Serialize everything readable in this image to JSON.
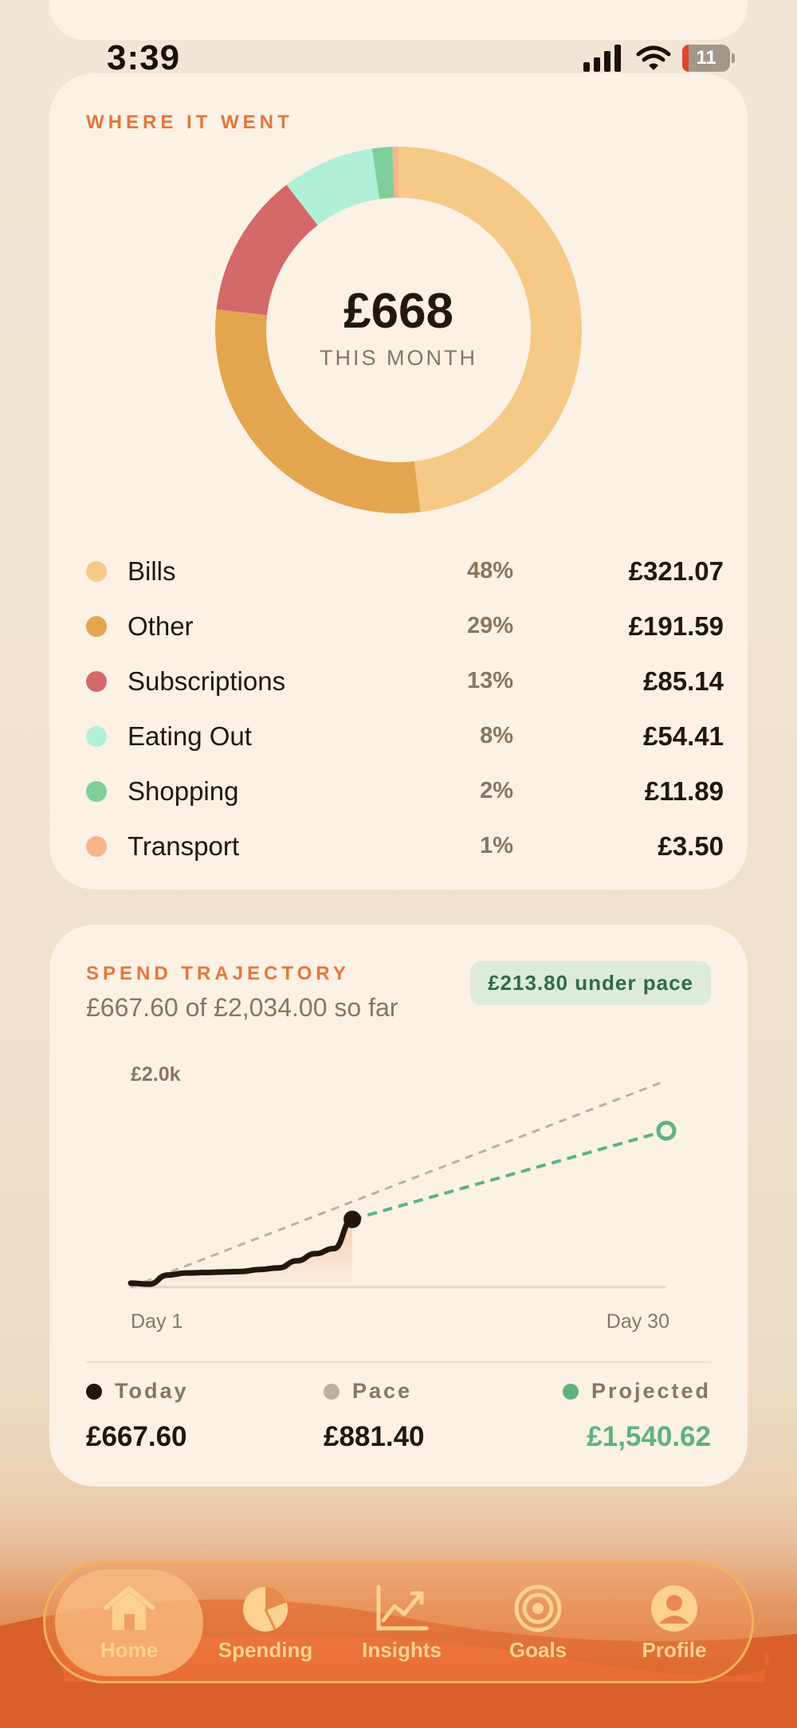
{
  "status_bar": {
    "time": "3:39",
    "battery": "11"
  },
  "where": {
    "title": "WHERE IT WENT",
    "total": "£668",
    "total_label": "THIS MONTH",
    "categories": [
      {
        "name": "Bills",
        "pct": "48%",
        "amount": "£321.07",
        "color": "#f6c987"
      },
      {
        "name": "Other",
        "pct": "29%",
        "amount": "£191.59",
        "color": "#e3a550"
      },
      {
        "name": "Subscriptions",
        "pct": "13%",
        "amount": "£85.14",
        "color": "#d4696a"
      },
      {
        "name": "Eating Out",
        "pct": "8%",
        "amount": "£54.41",
        "color": "#b1f0d6"
      },
      {
        "name": "Shopping",
        "pct": "2%",
        "amount": "£11.89",
        "color": "#7ecf9c"
      },
      {
        "name": "Transport",
        "pct": "1%",
        "amount": "£3.50",
        "color": "#f6b68a"
      }
    ]
  },
  "trajectory": {
    "title": "SPEND TRAJECTORY",
    "subtitle": "£667.60 of £2,034.00 so far",
    "badge": "£213.80 under pace",
    "y_label": "£2.0k",
    "x_start": "Day 1",
    "x_end": "Day 30",
    "stats": {
      "today_label": "Today",
      "today_value": "£667.60",
      "pace_label": "Pace",
      "pace_value": "£881.40",
      "projected_label": "Projected",
      "projected_value": "£1,540.62"
    },
    "colors": {
      "actual": "#24160c",
      "pace": "#bbb0a4",
      "projected": "#5cb47c"
    }
  },
  "chart_data": [
    {
      "type": "pie",
      "title": "WHERE IT WENT",
      "categories": [
        "Bills",
        "Other",
        "Subscriptions",
        "Eating Out",
        "Shopping",
        "Transport"
      ],
      "values": [
        321.07,
        191.59,
        85.14,
        54.41,
        11.89,
        3.5
      ],
      "percent": [
        48,
        29,
        13,
        8,
        2,
        1
      ],
      "colors": [
        "#f6c987",
        "#e3a550",
        "#d4696a",
        "#b1f0d6",
        "#7ecf9c",
        "#f6b68a"
      ]
    },
    {
      "type": "line",
      "title": "SPEND TRAJECTORY",
      "xlim": [
        1,
        30
      ],
      "ylim": [
        0,
        2000
      ],
      "series": [
        {
          "name": "Today",
          "x": [
            1,
            2,
            3,
            4,
            5,
            6,
            7,
            8,
            9,
            10,
            11,
            12,
            13
          ],
          "y": [
            40,
            30,
            120,
            140,
            145,
            150,
            155,
            175,
            190,
            260,
            330,
            380,
            667.6
          ]
        },
        {
          "name": "Pace",
          "x": [
            1,
            30
          ],
          "y": [
            0,
            2034
          ]
        },
        {
          "name": "Projected",
          "x": [
            13,
            30
          ],
          "y": [
            667.6,
            1540.62
          ]
        }
      ]
    }
  ],
  "nav": {
    "tabs": [
      {
        "label": "Home",
        "icon": "home-icon"
      },
      {
        "label": "Spending",
        "icon": "pie-chart-icon"
      },
      {
        "label": "Insights",
        "icon": "trend-icon"
      },
      {
        "label": "Goals",
        "icon": "target-icon"
      },
      {
        "label": "Profile",
        "icon": "profile-icon"
      }
    ]
  }
}
